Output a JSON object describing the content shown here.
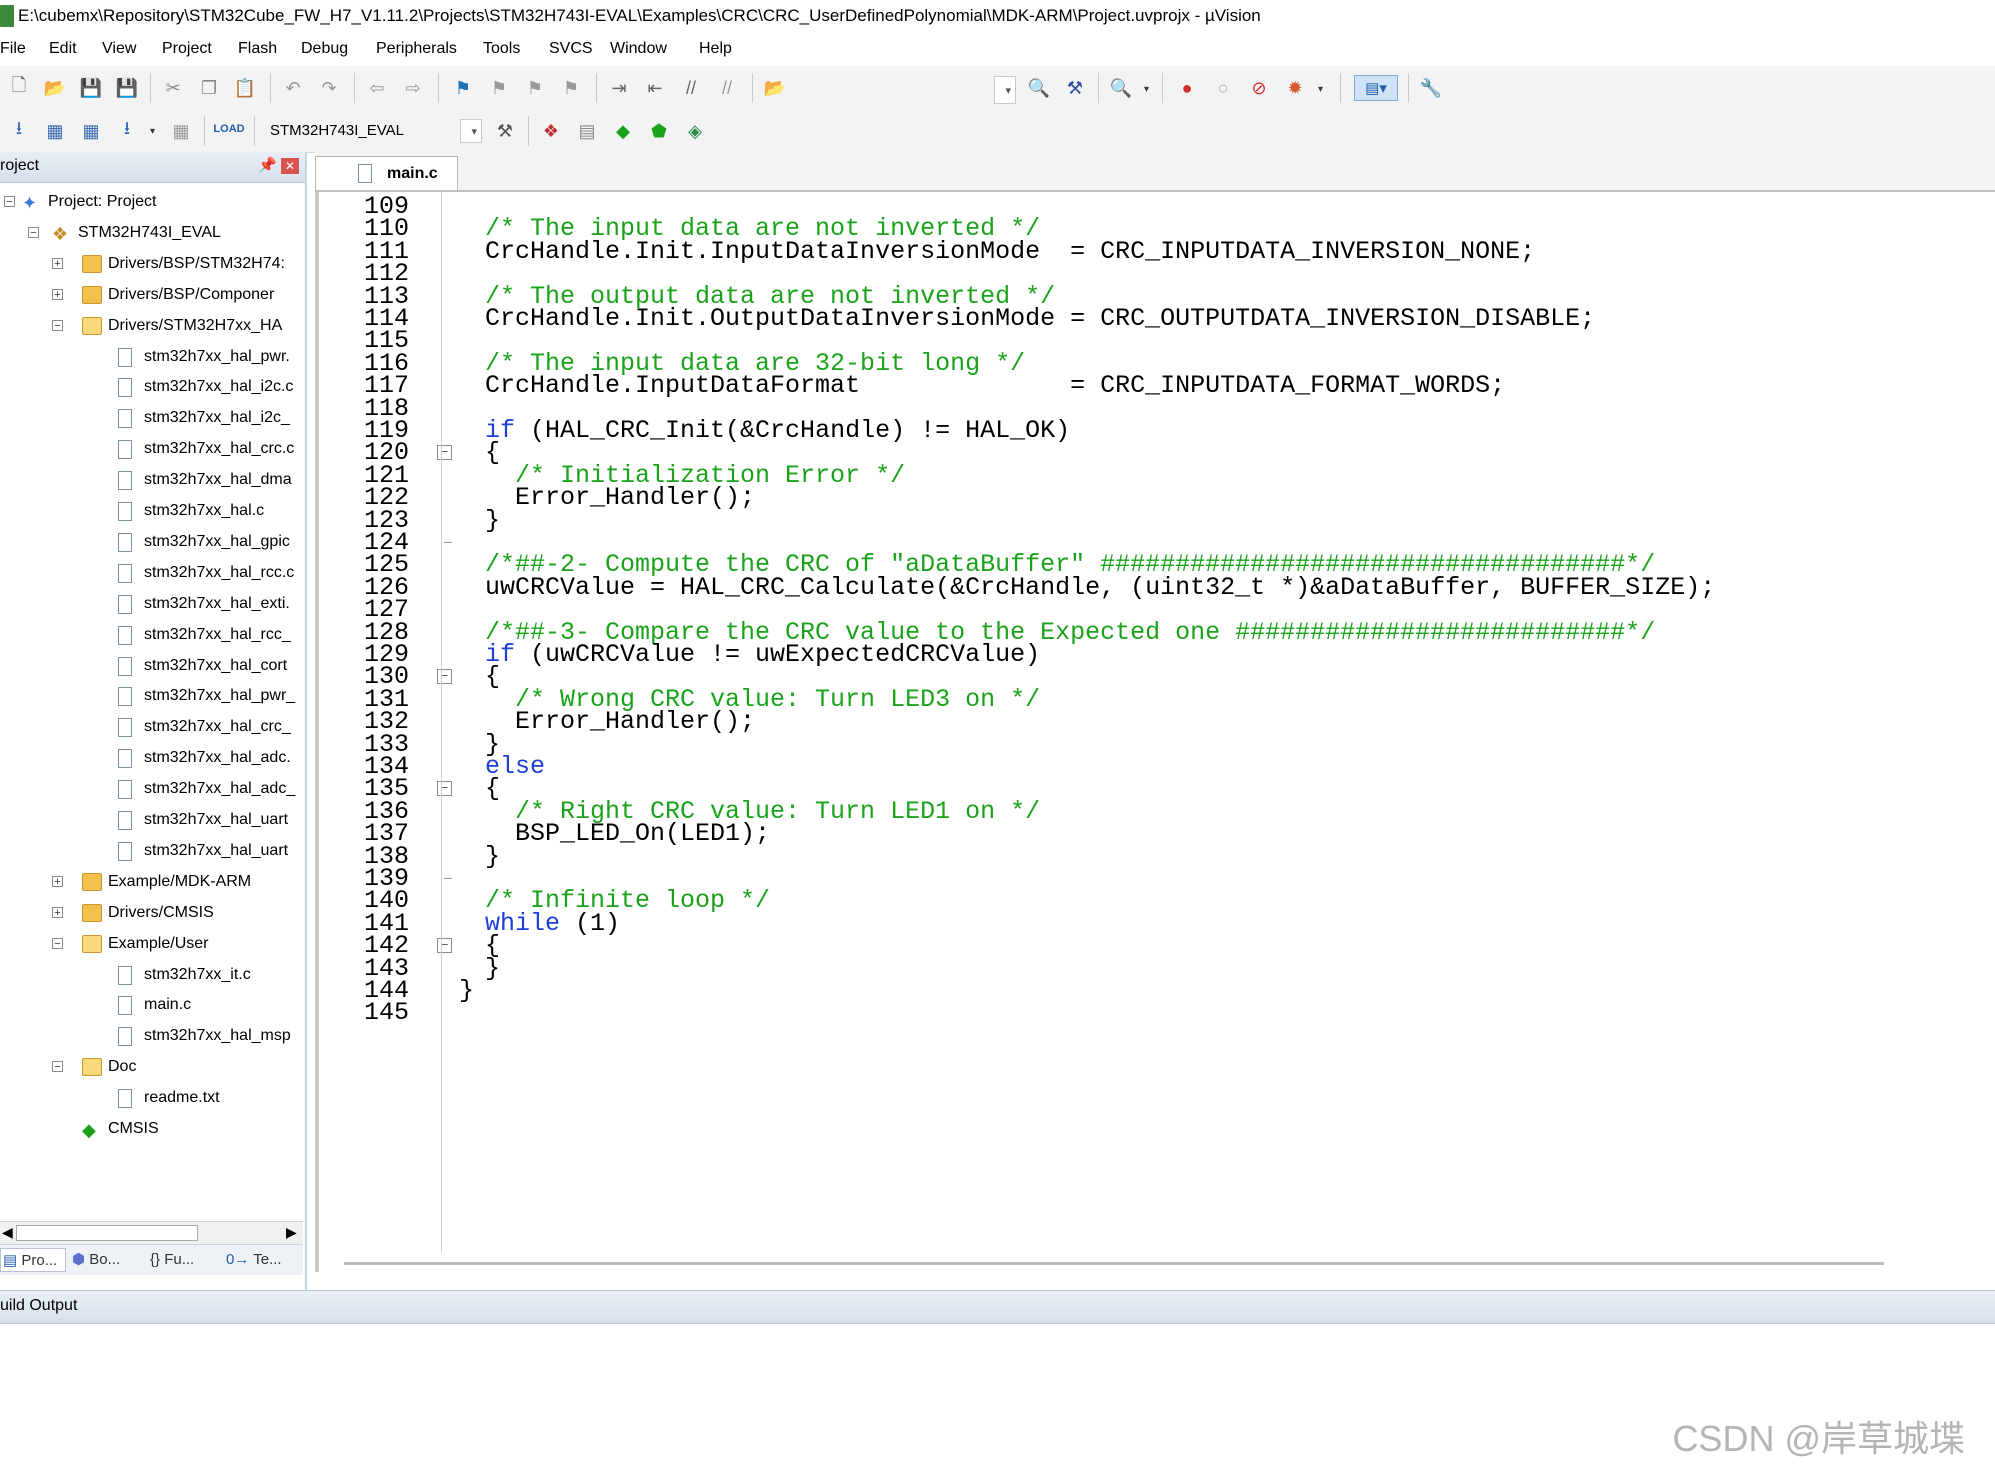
{
  "window": {
    "title": "E:\\cubemx\\Repository\\STM32Cube_FW_H7_V1.11.2\\Projects\\STM32H743I-EVAL\\Examples\\CRC\\CRC_UserDefinedPolynomial\\MDK-ARM\\Project.uvprojx - µVision"
  },
  "menu": [
    "File",
    "Edit",
    "View",
    "Project",
    "Flash",
    "Debug",
    "Peripherals",
    "Tools",
    "SVCS",
    "Window",
    "Help"
  ],
  "toolbar2": {
    "target": "STM32H743I_EVAL"
  },
  "project_panel": {
    "title": "roject",
    "tree": [
      {
        "label": "Project: Project",
        "level": 0,
        "kind": "root",
        "expanded": true
      },
      {
        "label": "STM32H743I_EVAL",
        "level": 1,
        "kind": "target",
        "expanded": true
      },
      {
        "label": "Drivers/BSP/STM32H74:",
        "level": 2,
        "kind": "folder",
        "expanded": false
      },
      {
        "label": "Drivers/BSP/Componer",
        "level": 2,
        "kind": "folder",
        "expanded": false
      },
      {
        "label": "Drivers/STM32H7xx_HA",
        "level": 2,
        "kind": "folder",
        "expanded": true
      },
      {
        "label": "stm32h7xx_hal_pwr.",
        "level": 3,
        "kind": "file"
      },
      {
        "label": "stm32h7xx_hal_i2c.c",
        "level": 3,
        "kind": "file"
      },
      {
        "label": "stm32h7xx_hal_i2c_",
        "level": 3,
        "kind": "file"
      },
      {
        "label": "stm32h7xx_hal_crc.c",
        "level": 3,
        "kind": "file"
      },
      {
        "label": "stm32h7xx_hal_dma",
        "level": 3,
        "kind": "file"
      },
      {
        "label": "stm32h7xx_hal.c",
        "level": 3,
        "kind": "file"
      },
      {
        "label": "stm32h7xx_hal_gpic",
        "level": 3,
        "kind": "file"
      },
      {
        "label": "stm32h7xx_hal_rcc.c",
        "level": 3,
        "kind": "file"
      },
      {
        "label": "stm32h7xx_hal_exti.",
        "level": 3,
        "kind": "file"
      },
      {
        "label": "stm32h7xx_hal_rcc_",
        "level": 3,
        "kind": "file"
      },
      {
        "label": "stm32h7xx_hal_cort",
        "level": 3,
        "kind": "file"
      },
      {
        "label": "stm32h7xx_hal_pwr_",
        "level": 3,
        "kind": "file"
      },
      {
        "label": "stm32h7xx_hal_crc_",
        "level": 3,
        "kind": "file"
      },
      {
        "label": "stm32h7xx_hal_adc.",
        "level": 3,
        "kind": "file"
      },
      {
        "label": "stm32h7xx_hal_adc_",
        "level": 3,
        "kind": "file"
      },
      {
        "label": "stm32h7xx_hal_uart",
        "level": 3,
        "kind": "file"
      },
      {
        "label": "stm32h7xx_hal_uart",
        "level": 3,
        "kind": "file"
      },
      {
        "label": "Example/MDK-ARM",
        "level": 2,
        "kind": "folder",
        "expanded": false
      },
      {
        "label": "Drivers/CMSIS",
        "level": 2,
        "kind": "folder",
        "expanded": false
      },
      {
        "label": "Example/User",
        "level": 2,
        "kind": "folder",
        "expanded": true
      },
      {
        "label": "stm32h7xx_it.c",
        "level": 3,
        "kind": "file"
      },
      {
        "label": "main.c",
        "level": 3,
        "kind": "file"
      },
      {
        "label": "stm32h7xx_hal_msp",
        "level": 3,
        "kind": "file"
      },
      {
        "label": "Doc",
        "level": 2,
        "kind": "folder",
        "expanded": true
      },
      {
        "label": "readme.txt",
        "level": 3,
        "kind": "file"
      },
      {
        "label": "CMSIS",
        "level": 2,
        "kind": "component"
      }
    ],
    "tabs": [
      "Pro...",
      "Bo...",
      "Fu...",
      "Te..."
    ]
  },
  "editor": {
    "active_tab": "main.c",
    "lines": [
      {
        "n": "109",
        "code": [],
        "fold": ""
      },
      {
        "n": "110",
        "code": [
          {
            "t": "/* The input data are not inverted */",
            "c": "cm"
          }
        ],
        "fold": ""
      },
      {
        "n": "111",
        "code": [
          {
            "t": "CrcHandle.Init.InputDataInversionMode  = CRC_INPUTDATA_INVERSION_NONE;",
            "c": "pl"
          }
        ],
        "fold": ""
      },
      {
        "n": "112",
        "code": [],
        "fold": ""
      },
      {
        "n": "113",
        "code": [
          {
            "t": "/* The output data are not inverted */",
            "c": "cm"
          }
        ],
        "fold": ""
      },
      {
        "n": "114",
        "code": [
          {
            "t": "CrcHandle.Init.OutputDataInversionMode = CRC_OUTPUTDATA_INVERSION_DISABLE;",
            "c": "pl"
          }
        ],
        "fold": ""
      },
      {
        "n": "115",
        "code": [],
        "fold": ""
      },
      {
        "n": "116",
        "code": [
          {
            "t": "/* The input data are 32-bit long */",
            "c": "cm"
          }
        ],
        "fold": ""
      },
      {
        "n": "117",
        "code": [
          {
            "t": "CrcHandle.InputDataFormat              = CRC_INPUTDATA_FORMAT_WORDS;",
            "c": "pl"
          }
        ],
        "fold": ""
      },
      {
        "n": "118",
        "code": [],
        "fold": ""
      },
      {
        "n": "119",
        "code": [
          {
            "t": "if",
            "c": "kw"
          },
          {
            "t": " (HAL_CRC_Init(&CrcHandle) != HAL_OK)",
            "c": "pl"
          }
        ],
        "fold": ""
      },
      {
        "n": "120",
        "code": [
          {
            "t": "{",
            "c": "pl"
          }
        ],
        "fold": "box"
      },
      {
        "n": "121",
        "code": [
          {
            "t": "  /* Initialization Error */",
            "c": "cm"
          }
        ],
        "fold": ""
      },
      {
        "n": "122",
        "code": [
          {
            "t": "  Error_Handler();",
            "c": "pl"
          }
        ],
        "fold": ""
      },
      {
        "n": "123",
        "code": [
          {
            "t": "}",
            "c": "pl"
          }
        ],
        "fold": ""
      },
      {
        "n": "124",
        "code": [],
        "fold": "tick"
      },
      {
        "n": "125",
        "code": [
          {
            "t": "/*##-2- Compute the CRC of \"aDataBuffer\" ###################################*/",
            "c": "cm"
          }
        ],
        "fold": ""
      },
      {
        "n": "126",
        "code": [
          {
            "t": "uwCRCValue = HAL_CRC_Calculate(&CrcHandle, (uint32_t *)&aDataBuffer, BUFFER_SIZE);",
            "c": "pl"
          }
        ],
        "fold": ""
      },
      {
        "n": "127",
        "code": [],
        "fold": ""
      },
      {
        "n": "128",
        "code": [
          {
            "t": "/*##-3- Compare the CRC value to the Expected one ##########################*/",
            "c": "cm"
          }
        ],
        "fold": ""
      },
      {
        "n": "129",
        "code": [
          {
            "t": "if",
            "c": "kw"
          },
          {
            "t": " (uwCRCValue != uwExpectedCRCValue)",
            "c": "pl"
          }
        ],
        "fold": ""
      },
      {
        "n": "130",
        "code": [
          {
            "t": "{",
            "c": "pl"
          }
        ],
        "fold": "box"
      },
      {
        "n": "131",
        "code": [
          {
            "t": "  /* Wrong CRC value: Turn LED3 on */",
            "c": "cm"
          }
        ],
        "fold": ""
      },
      {
        "n": "132",
        "code": [
          {
            "t": "  Error_Handler();",
            "c": "pl"
          }
        ],
        "fold": ""
      },
      {
        "n": "133",
        "code": [
          {
            "t": "}",
            "c": "pl"
          }
        ],
        "fold": ""
      },
      {
        "n": "134",
        "code": [
          {
            "t": "else",
            "c": "kw"
          }
        ],
        "fold": ""
      },
      {
        "n": "135",
        "code": [
          {
            "t": "{",
            "c": "pl"
          }
        ],
        "fold": "box"
      },
      {
        "n": "136",
        "code": [
          {
            "t": "  /* Right CRC value: Turn LED1 on */",
            "c": "cm"
          }
        ],
        "fold": ""
      },
      {
        "n": "137",
        "code": [
          {
            "t": "  BSP_LED_On(LED1);",
            "c": "pl"
          }
        ],
        "fold": ""
      },
      {
        "n": "138",
        "code": [
          {
            "t": "}",
            "c": "pl"
          }
        ],
        "fold": ""
      },
      {
        "n": "139",
        "code": [],
        "fold": "tick"
      },
      {
        "n": "140",
        "code": [
          {
            "t": "/* Infinite loop */",
            "c": "cm"
          }
        ],
        "fold": ""
      },
      {
        "n": "141",
        "code": [
          {
            "t": "while",
            "c": "kw"
          },
          {
            "t": " (1)",
            "c": "pl"
          }
        ],
        "fold": ""
      },
      {
        "n": "142",
        "code": [
          {
            "t": "{",
            "c": "pl"
          }
        ],
        "fold": "box"
      },
      {
        "n": "143",
        "code": [
          {
            "t": "}",
            "c": "pl"
          }
        ],
        "fold": ""
      },
      {
        "n": "144",
        "code": [
          {
            "t": "}",
            "c": "pl"
          }
        ],
        "fold": "close"
      },
      {
        "n": "145",
        "code": [],
        "fold": ""
      }
    ]
  },
  "build_output": {
    "label": "uild Output"
  },
  "watermark": "CSDN @岸草城堞",
  "colors": {
    "comment": "#1aa31a",
    "keyword": "#1d3fd6",
    "panel_header": "#d6e0ec"
  }
}
